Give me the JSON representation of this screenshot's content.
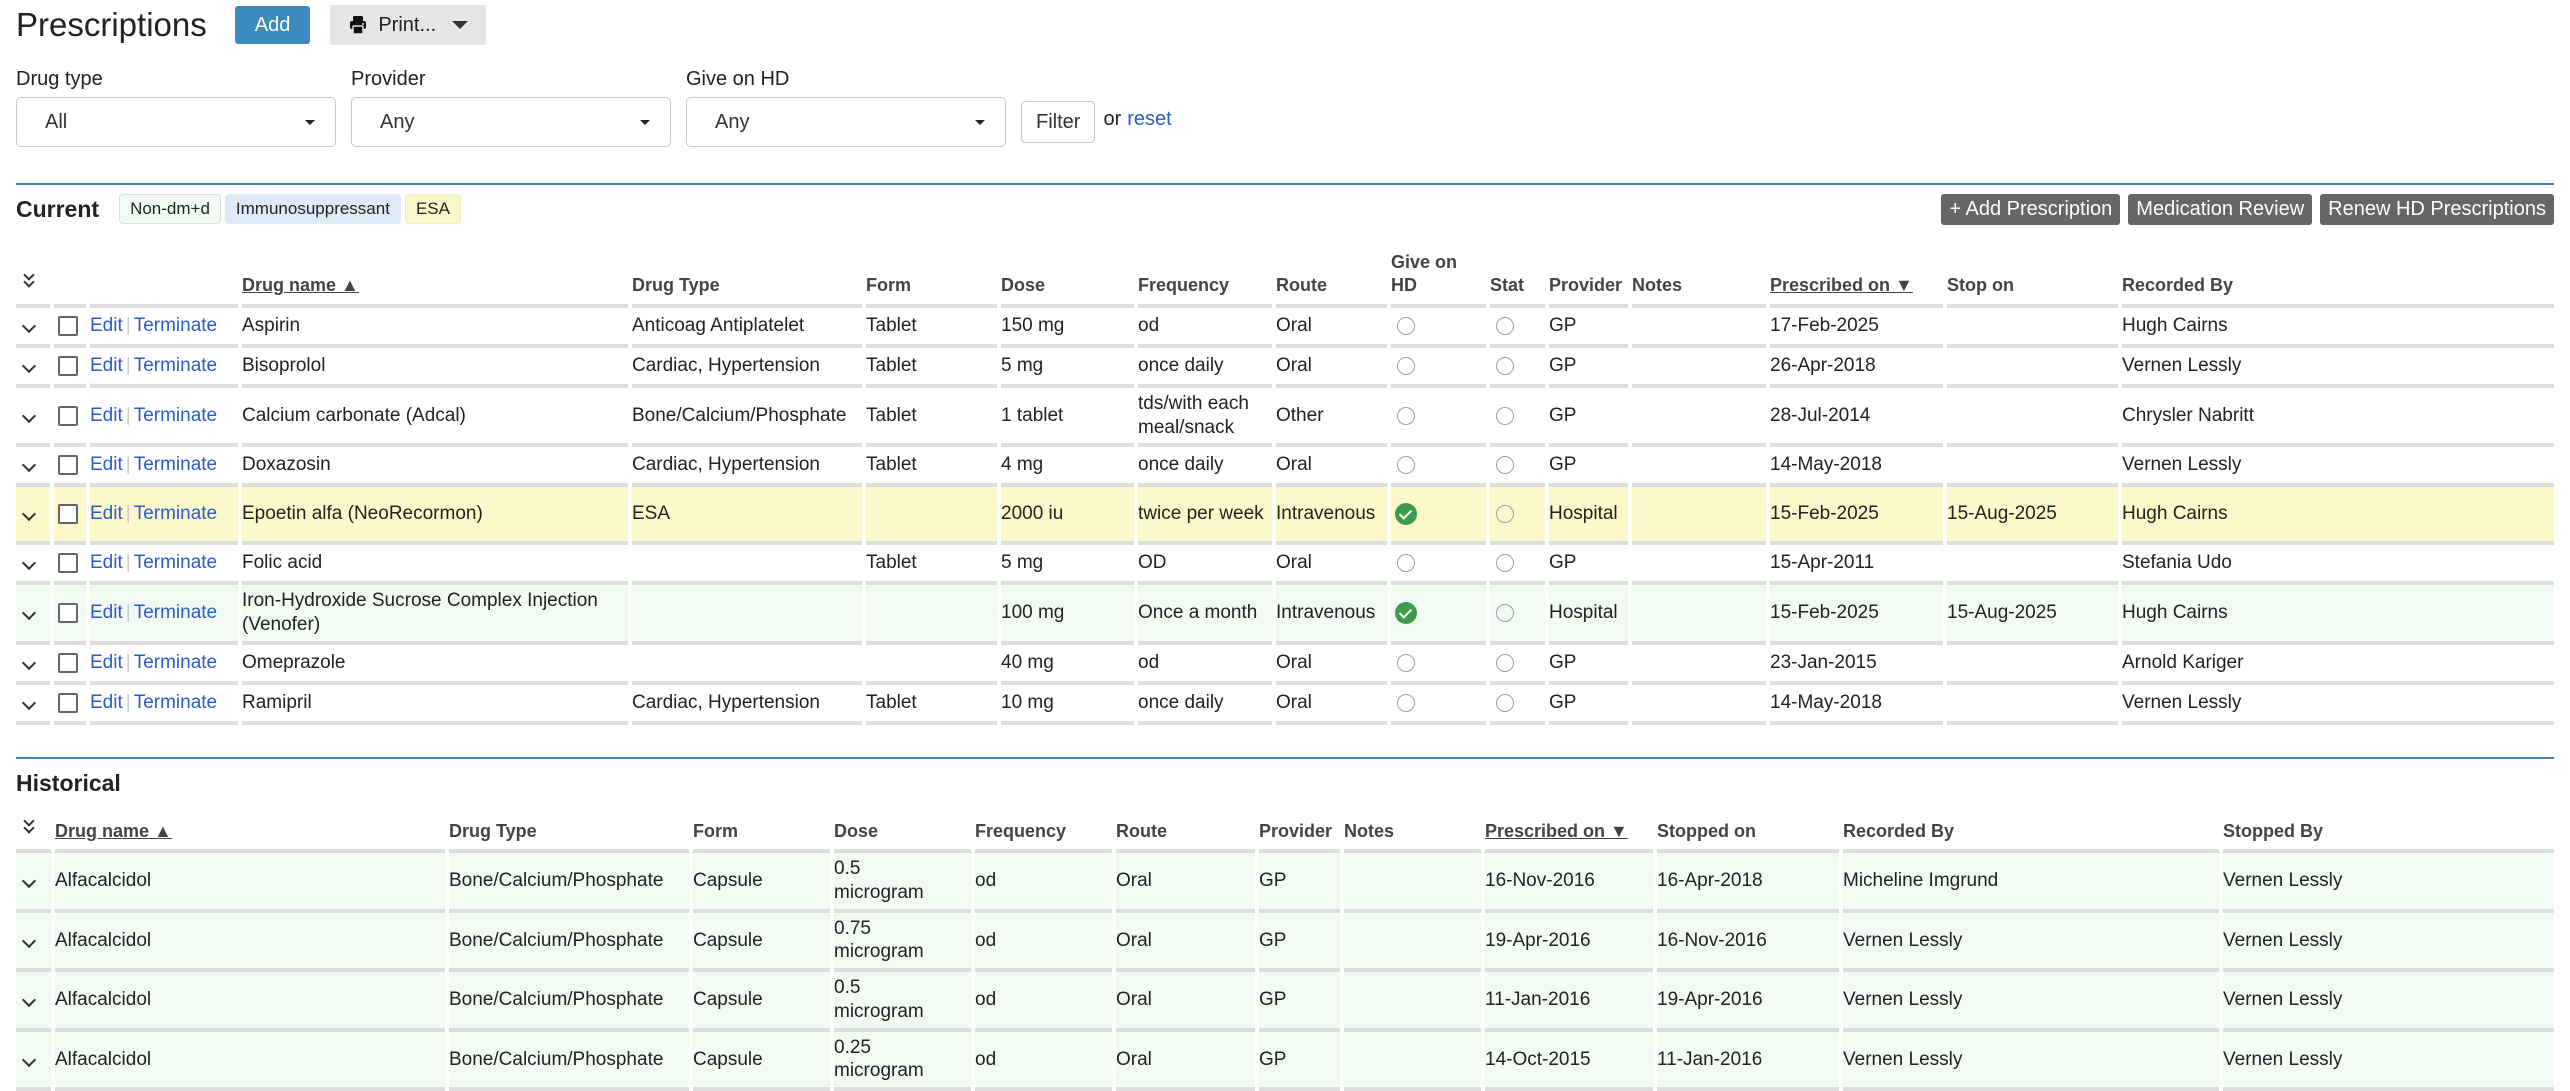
{
  "header": {
    "title": "Prescriptions",
    "add_label": "Add",
    "print_label": "Print..."
  },
  "filters": {
    "drug_type": {
      "label": "Drug type",
      "value": "All"
    },
    "provider": {
      "label": "Provider",
      "value": "Any"
    },
    "give_on_hd": {
      "label": "Give on HD",
      "value": "Any"
    },
    "filter_label": "Filter",
    "or_text": "or",
    "reset_label": "reset"
  },
  "current": {
    "title": "Current",
    "legend": {
      "nondmd": "Non-dm+d",
      "immuno": "Immunosuppressant",
      "esa": "ESA"
    },
    "actions": {
      "add": "+ Add Prescription",
      "review": "Medication Review",
      "renew": "Renew HD Prescriptions"
    },
    "columns": {
      "drug_name": "Drug name ▲",
      "drug_type": "Drug Type",
      "form": "Form",
      "dose": "Dose",
      "frequency": "Frequency",
      "route": "Route",
      "give_on_hd_1": "Give on",
      "give_on_hd_2": "HD",
      "stat": "Stat",
      "provider": "Provider",
      "notes": "Notes",
      "prescribed_on": "Prescribed on ▼",
      "stop_on": "Stop on",
      "recorded_by": "Recorded By"
    },
    "edit_label": "Edit",
    "terminate_label": "Terminate",
    "rows": [
      {
        "drug": "Aspirin",
        "type": "Anticoag Antiplatelet",
        "form": "Tablet",
        "dose": "150 mg",
        "freq": "od",
        "route": "Oral",
        "hd": false,
        "stat": false,
        "provider": "GP",
        "notes": "",
        "prescribed": "17-Feb-2025",
        "stop": "",
        "recorded": "Hugh Cairns",
        "style": ""
      },
      {
        "drug": "Bisoprolol",
        "type": "Cardiac, Hypertension",
        "form": "Tablet",
        "dose": "5 mg",
        "freq": "once daily",
        "route": "Oral",
        "hd": false,
        "stat": false,
        "provider": "GP",
        "notes": "",
        "prescribed": "26-Apr-2018",
        "stop": "",
        "recorded": "Vernen Lessly",
        "style": ""
      },
      {
        "drug": "Calcium carbonate (Adcal)",
        "type": "Bone/Calcium/Phosphate",
        "form": "Tablet",
        "dose": "1 tablet",
        "freq": "tds/with each meal/snack",
        "route": "Other",
        "hd": false,
        "stat": false,
        "provider": "GP",
        "notes": "",
        "prescribed": "28-Jul-2014",
        "stop": "",
        "recorded": "Chrysler Nabritt",
        "style": ""
      },
      {
        "drug": "Doxazosin",
        "type": "Cardiac, Hypertension",
        "form": "Tablet",
        "dose": "4 mg",
        "freq": "once daily",
        "route": "Oral",
        "hd": false,
        "stat": false,
        "provider": "GP",
        "notes": "",
        "prescribed": "14-May-2018",
        "stop": "",
        "recorded": "Vernen Lessly",
        "style": ""
      },
      {
        "drug": "Epoetin alfa (NeoRecormon)",
        "type": "ESA",
        "form": "",
        "dose": "2000 iu",
        "freq": "twice per week",
        "route": "Intravenous",
        "hd": true,
        "stat": false,
        "provider": "Hospital",
        "notes": "",
        "prescribed": "15-Feb-2025",
        "stop": "15-Aug-2025",
        "recorded": "Hugh Cairns",
        "style": "esa"
      },
      {
        "drug": "Folic acid",
        "type": "",
        "form": "Tablet",
        "dose": "5 mg",
        "freq": "OD",
        "route": "Oral",
        "hd": false,
        "stat": false,
        "provider": "GP",
        "notes": "",
        "prescribed": "15-Apr-2011",
        "stop": "",
        "recorded": "Stefania Udo",
        "style": ""
      },
      {
        "drug": "Iron-Hydroxide Sucrose Complex Injection (Venofer)",
        "type": "",
        "form": "",
        "dose": "100 mg",
        "freq": "Once a month",
        "route": "Intravenous",
        "hd": true,
        "stat": false,
        "provider": "Hospital",
        "notes": "",
        "prescribed": "15-Feb-2025",
        "stop": "15-Aug-2025",
        "recorded": "Hugh Cairns",
        "style": "nondmd"
      },
      {
        "drug": "Omeprazole",
        "type": "",
        "form": "",
        "dose": "40 mg",
        "freq": "od",
        "route": "Oral",
        "hd": false,
        "stat": false,
        "provider": "GP",
        "notes": "",
        "prescribed": "23-Jan-2015",
        "stop": "",
        "recorded": "Arnold Kariger",
        "style": ""
      },
      {
        "drug": "Ramipril",
        "type": "Cardiac, Hypertension",
        "form": "Tablet",
        "dose": "10 mg",
        "freq": "once daily",
        "route": "Oral",
        "hd": false,
        "stat": false,
        "provider": "GP",
        "notes": "",
        "prescribed": "14-May-2018",
        "stop": "",
        "recorded": "Vernen Lessly",
        "style": ""
      }
    ]
  },
  "historical": {
    "title": "Historical",
    "columns": {
      "drug_name": "Drug name ▲",
      "drug_type": "Drug Type",
      "form": "Form",
      "dose": "Dose",
      "frequency": "Frequency",
      "route": "Route",
      "provider": "Provider",
      "notes": "Notes",
      "prescribed_on": "Prescribed on ▼",
      "stopped_on": "Stopped on",
      "recorded_by": "Recorded By",
      "stopped_by": "Stopped By"
    },
    "rows": [
      {
        "drug": "Alfacalcidol",
        "type": "Bone/Calcium/Phosphate",
        "form": "Capsule",
        "dose": "0.5 microgram",
        "freq": "od",
        "route": "Oral",
        "provider": "GP",
        "notes": "",
        "prescribed": "16-Nov-2016",
        "stopped": "16-Apr-2018",
        "recorded": "Micheline Imgrund",
        "stopped_by": "Vernen Lessly"
      },
      {
        "drug": "Alfacalcidol",
        "type": "Bone/Calcium/Phosphate",
        "form": "Capsule",
        "dose": "0.75 microgram",
        "freq": "od",
        "route": "Oral",
        "provider": "GP",
        "notes": "",
        "prescribed": "19-Apr-2016",
        "stopped": "16-Nov-2016",
        "recorded": "Vernen Lessly",
        "stopped_by": "Vernen Lessly"
      },
      {
        "drug": "Alfacalcidol",
        "type": "Bone/Calcium/Phosphate",
        "form": "Capsule",
        "dose": "0.5 microgram",
        "freq": "od",
        "route": "Oral",
        "provider": "GP",
        "notes": "",
        "prescribed": "11-Jan-2016",
        "stopped": "19-Apr-2016",
        "recorded": "Vernen Lessly",
        "stopped_by": "Vernen Lessly"
      },
      {
        "drug": "Alfacalcidol",
        "type": "Bone/Calcium/Phosphate",
        "form": "Capsule",
        "dose": "0.25 microgram",
        "freq": "od",
        "route": "Oral",
        "provider": "GP",
        "notes": "",
        "prescribed": "14-Oct-2015",
        "stopped": "11-Jan-2016",
        "recorded": "Vernen Lessly",
        "stopped_by": "Vernen Lessly"
      }
    ]
  }
}
